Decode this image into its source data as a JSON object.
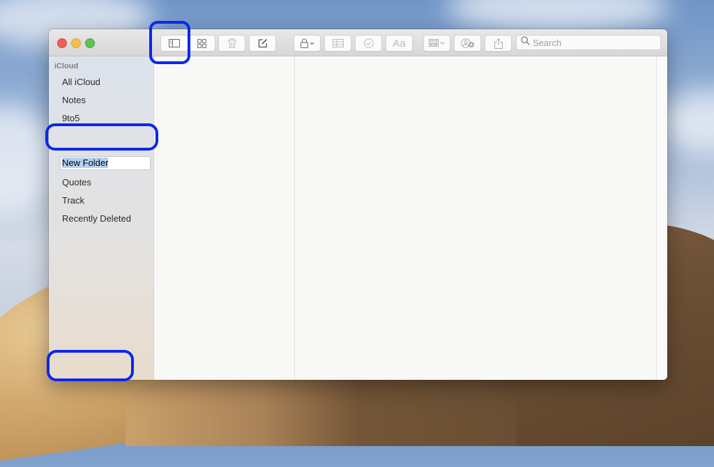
{
  "window": {
    "traffic_lights": {
      "close": "close-window",
      "minimize": "minimize-window",
      "zoom": "zoom-window"
    }
  },
  "toolbar": {
    "buttons": [
      {
        "name": "toggle-sidebar-button",
        "icon": "sidebar-icon",
        "glyph": "▯"
      },
      {
        "name": "gallery-view-button",
        "icon": "grid-icon",
        "glyph": "⊞"
      },
      {
        "name": "delete-button",
        "icon": "trash-icon",
        "glyph": "🗑"
      },
      {
        "name": "compose-button",
        "icon": "compose-icon",
        "glyph": "✎"
      },
      {
        "name": "lock-button",
        "icon": "lock-icon",
        "glyph": "🔒"
      },
      {
        "name": "table-button",
        "icon": "table-icon",
        "glyph": "▦"
      },
      {
        "name": "checklist-button",
        "icon": "checkmark-circle-icon",
        "glyph": "✓"
      },
      {
        "name": "format-button",
        "icon": "text-format-icon",
        "glyph": "Aa"
      },
      {
        "name": "media-button",
        "icon": "photo-icon",
        "glyph": "▣"
      },
      {
        "name": "add-people-button",
        "icon": "add-person-icon",
        "glyph": "👤"
      },
      {
        "name": "share-button",
        "icon": "share-icon",
        "glyph": "⇧"
      }
    ],
    "format_label": "Aa",
    "search": {
      "placeholder": "Search",
      "value": ""
    }
  },
  "sidebar": {
    "section": "iCloud",
    "items": [
      {
        "label": "All iCloud"
      },
      {
        "label": "Notes"
      },
      {
        "label": "9to5"
      },
      {
        "label": "New Folder",
        "editing": true
      },
      {
        "label": "Quotes"
      },
      {
        "label": "Track"
      },
      {
        "label": "Recently Deleted"
      }
    ],
    "new_folder_label": "New Folder"
  },
  "annotations": {
    "highlight_color": "#0a26f2"
  }
}
